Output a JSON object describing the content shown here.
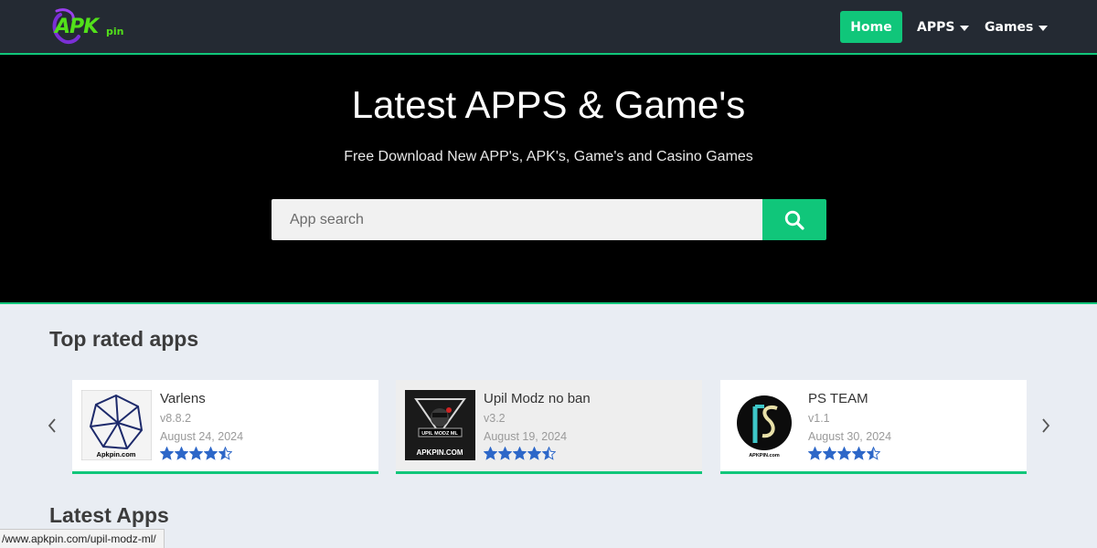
{
  "header": {
    "logo_text": "APK",
    "logo_sup": "pin",
    "nav": {
      "home": "Home",
      "apps": "APPS",
      "games": "Games"
    }
  },
  "hero": {
    "title": "Latest APPS & Game's",
    "subtitle": "Free Download New APP's, APK's, Game's and Casino Games",
    "search": {
      "placeholder": "App search",
      "value": ""
    }
  },
  "sections": {
    "top_rated": "Top rated apps",
    "latest": "Latest Apps"
  },
  "apps": [
    {
      "name": "Varlens",
      "version": "v8.8.2",
      "date": "August 24, 2024",
      "rating": 4.5,
      "image_caption": "Apkpin.com"
    },
    {
      "name": "Upil Modz no ban",
      "version": "v3.2",
      "date": "August 19, 2024",
      "rating": 4.5,
      "image_caption": "APKPIN.COM",
      "image_label": "UPIL MODZ ML"
    },
    {
      "name": "PS TEAM",
      "version": "v1.1",
      "date": "August 30, 2024",
      "rating": 4.5,
      "image_caption": "APKPIN.com"
    }
  ],
  "status_bar": {
    "url": "/www.apkpin.com/upil-modz-ml/"
  },
  "colors": {
    "accent": "#10c67a",
    "navbar": "#242a33",
    "hero_bg": "#000000",
    "page_bg": "#e9edf3",
    "star": "#2d67c8"
  },
  "icons": [
    "search-icon",
    "caret-down-icon",
    "chevron-left-icon",
    "chevron-right-icon",
    "star-icon"
  ]
}
